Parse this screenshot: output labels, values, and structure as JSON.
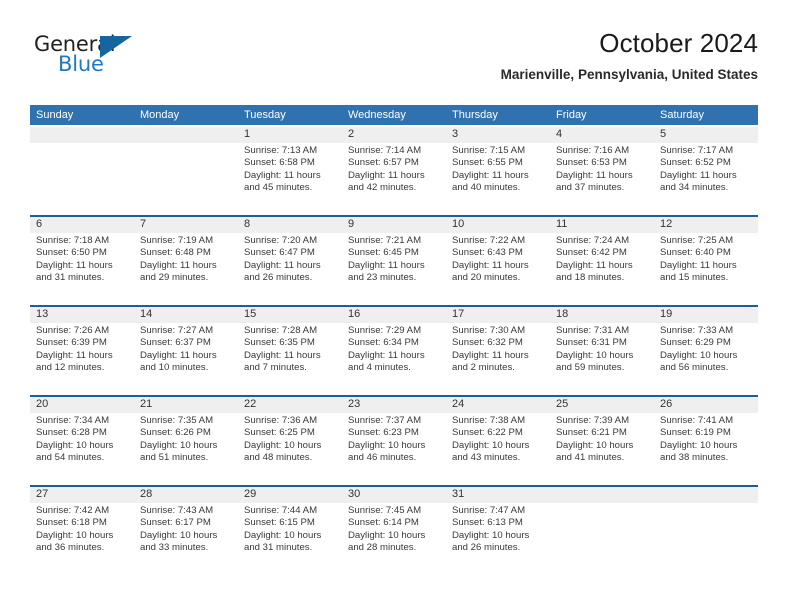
{
  "brand": {
    "name_line1": "General",
    "name_line2": "Blue",
    "triangle_color": "#15659f",
    "blue_color": "#1f7ac4"
  },
  "header": {
    "title": "October 2024",
    "subtitle": "Marienville, Pennsylvania, United States"
  },
  "colors": {
    "header_band": "#3071b0",
    "week_rule": "#1f5d96",
    "date_band": "#efefef",
    "text": "#3a3a3a"
  },
  "calendar": {
    "weekday_headers": [
      "Sunday",
      "Monday",
      "Tuesday",
      "Wednesday",
      "Thursday",
      "Friday",
      "Saturday"
    ],
    "weeks": [
      [
        {
          "day": "",
          "info": ""
        },
        {
          "day": "",
          "info": ""
        },
        {
          "day": "1",
          "info": "Sunrise: 7:13 AM\nSunset: 6:58 PM\nDaylight: 11 hours\nand 45 minutes."
        },
        {
          "day": "2",
          "info": "Sunrise: 7:14 AM\nSunset: 6:57 PM\nDaylight: 11 hours\nand 42 minutes."
        },
        {
          "day": "3",
          "info": "Sunrise: 7:15 AM\nSunset: 6:55 PM\nDaylight: 11 hours\nand 40 minutes."
        },
        {
          "day": "4",
          "info": "Sunrise: 7:16 AM\nSunset: 6:53 PM\nDaylight: 11 hours\nand 37 minutes."
        },
        {
          "day": "5",
          "info": "Sunrise: 7:17 AM\nSunset: 6:52 PM\nDaylight: 11 hours\nand 34 minutes."
        }
      ],
      [
        {
          "day": "6",
          "info": "Sunrise: 7:18 AM\nSunset: 6:50 PM\nDaylight: 11 hours\nand 31 minutes."
        },
        {
          "day": "7",
          "info": "Sunrise: 7:19 AM\nSunset: 6:48 PM\nDaylight: 11 hours\nand 29 minutes."
        },
        {
          "day": "8",
          "info": "Sunrise: 7:20 AM\nSunset: 6:47 PM\nDaylight: 11 hours\nand 26 minutes."
        },
        {
          "day": "9",
          "info": "Sunrise: 7:21 AM\nSunset: 6:45 PM\nDaylight: 11 hours\nand 23 minutes."
        },
        {
          "day": "10",
          "info": "Sunrise: 7:22 AM\nSunset: 6:43 PM\nDaylight: 11 hours\nand 20 minutes."
        },
        {
          "day": "11",
          "info": "Sunrise: 7:24 AM\nSunset: 6:42 PM\nDaylight: 11 hours\nand 18 minutes."
        },
        {
          "day": "12",
          "info": "Sunrise: 7:25 AM\nSunset: 6:40 PM\nDaylight: 11 hours\nand 15 minutes."
        }
      ],
      [
        {
          "day": "13",
          "info": "Sunrise: 7:26 AM\nSunset: 6:39 PM\nDaylight: 11 hours\nand 12 minutes."
        },
        {
          "day": "14",
          "info": "Sunrise: 7:27 AM\nSunset: 6:37 PM\nDaylight: 11 hours\nand 10 minutes."
        },
        {
          "day": "15",
          "info": "Sunrise: 7:28 AM\nSunset: 6:35 PM\nDaylight: 11 hours\nand 7 minutes."
        },
        {
          "day": "16",
          "info": "Sunrise: 7:29 AM\nSunset: 6:34 PM\nDaylight: 11 hours\nand 4 minutes."
        },
        {
          "day": "17",
          "info": "Sunrise: 7:30 AM\nSunset: 6:32 PM\nDaylight: 11 hours\nand 2 minutes."
        },
        {
          "day": "18",
          "info": "Sunrise: 7:31 AM\nSunset: 6:31 PM\nDaylight: 10 hours\nand 59 minutes."
        },
        {
          "day": "19",
          "info": "Sunrise: 7:33 AM\nSunset: 6:29 PM\nDaylight: 10 hours\nand 56 minutes."
        }
      ],
      [
        {
          "day": "20",
          "info": "Sunrise: 7:34 AM\nSunset: 6:28 PM\nDaylight: 10 hours\nand 54 minutes."
        },
        {
          "day": "21",
          "info": "Sunrise: 7:35 AM\nSunset: 6:26 PM\nDaylight: 10 hours\nand 51 minutes."
        },
        {
          "day": "22",
          "info": "Sunrise: 7:36 AM\nSunset: 6:25 PM\nDaylight: 10 hours\nand 48 minutes."
        },
        {
          "day": "23",
          "info": "Sunrise: 7:37 AM\nSunset: 6:23 PM\nDaylight: 10 hours\nand 46 minutes."
        },
        {
          "day": "24",
          "info": "Sunrise: 7:38 AM\nSunset: 6:22 PM\nDaylight: 10 hours\nand 43 minutes."
        },
        {
          "day": "25",
          "info": "Sunrise: 7:39 AM\nSunset: 6:21 PM\nDaylight: 10 hours\nand 41 minutes."
        },
        {
          "day": "26",
          "info": "Sunrise: 7:41 AM\nSunset: 6:19 PM\nDaylight: 10 hours\nand 38 minutes."
        }
      ],
      [
        {
          "day": "27",
          "info": "Sunrise: 7:42 AM\nSunset: 6:18 PM\nDaylight: 10 hours\nand 36 minutes."
        },
        {
          "day": "28",
          "info": "Sunrise: 7:43 AM\nSunset: 6:17 PM\nDaylight: 10 hours\nand 33 minutes."
        },
        {
          "day": "29",
          "info": "Sunrise: 7:44 AM\nSunset: 6:15 PM\nDaylight: 10 hours\nand 31 minutes."
        },
        {
          "day": "30",
          "info": "Sunrise: 7:45 AM\nSunset: 6:14 PM\nDaylight: 10 hours\nand 28 minutes."
        },
        {
          "day": "31",
          "info": "Sunrise: 7:47 AM\nSunset: 6:13 PM\nDaylight: 10 hours\nand 26 minutes."
        },
        {
          "day": "",
          "info": ""
        },
        {
          "day": "",
          "info": ""
        }
      ]
    ]
  }
}
